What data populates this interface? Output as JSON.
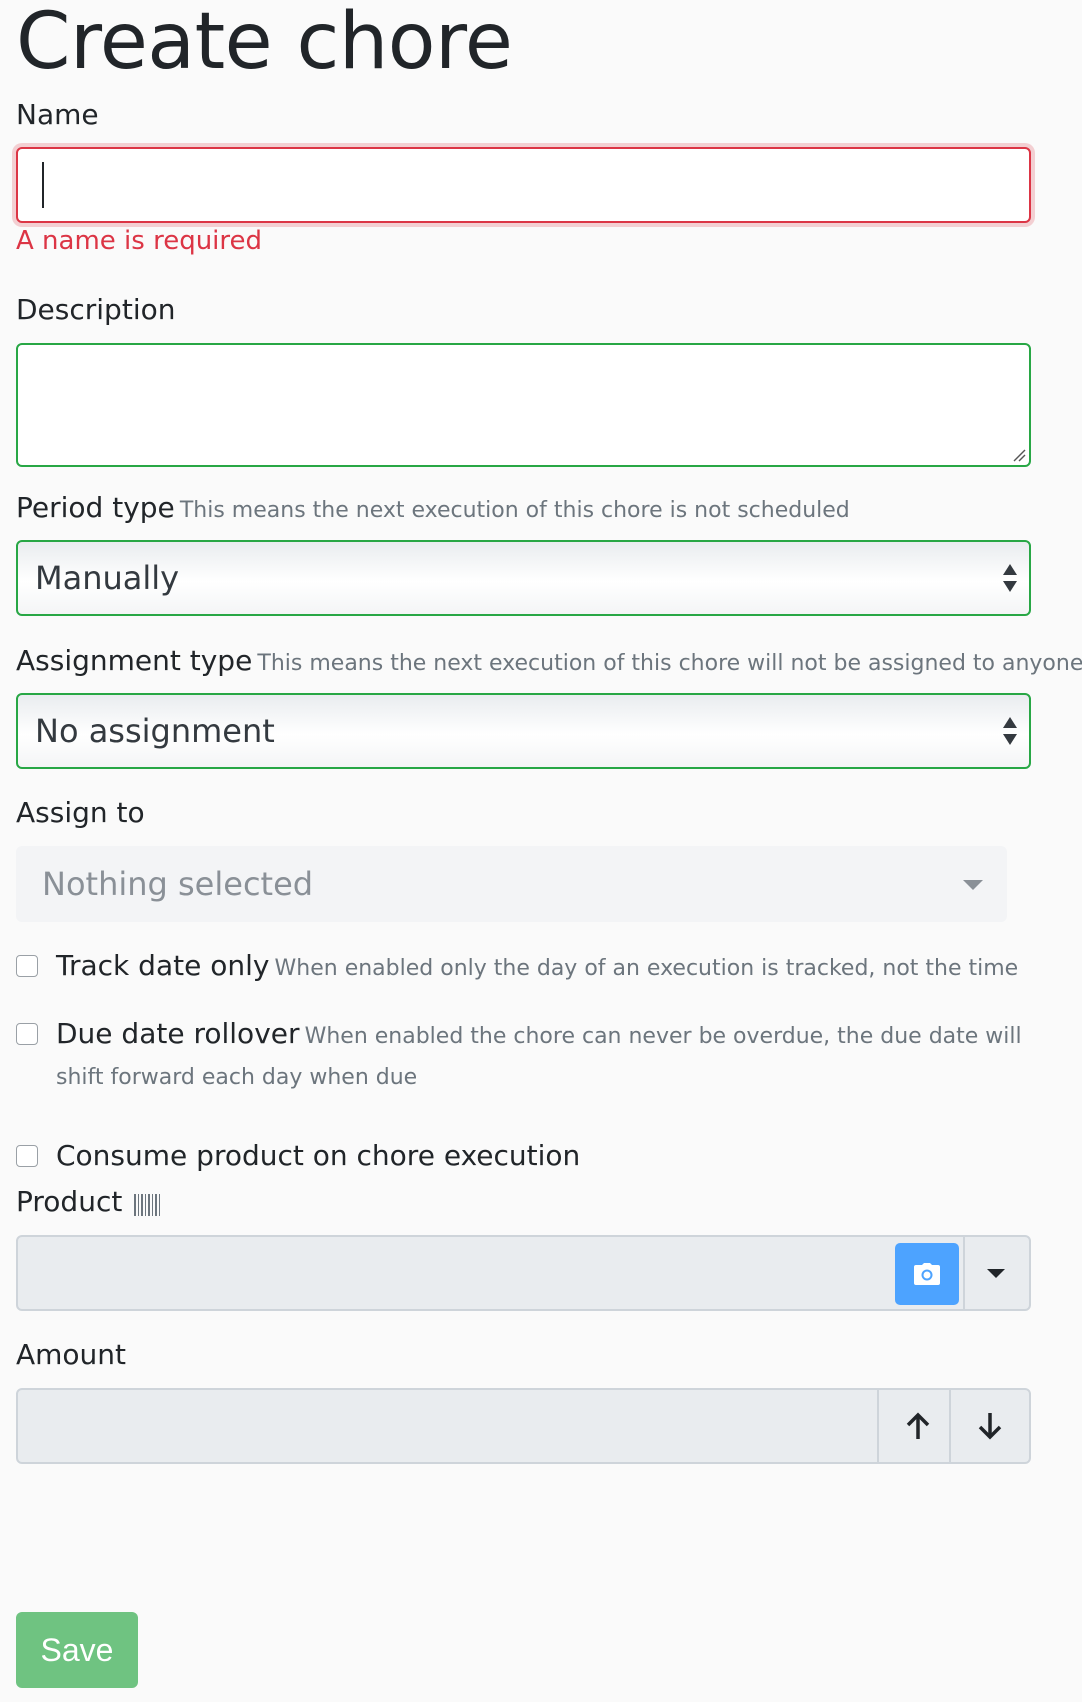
{
  "page": {
    "title": "Create chore"
  },
  "name_field": {
    "label": "Name",
    "value": "",
    "error": "A name is required"
  },
  "description_field": {
    "label": "Description",
    "value": ""
  },
  "period_type": {
    "label": "Period type",
    "hint": "This means the next execution of this chore is not scheduled",
    "selected": "Manually"
  },
  "assignment_type": {
    "label": "Assignment type",
    "hint": "This means the next execution of this chore will not be assigned to anyone",
    "selected": "No assignment"
  },
  "assign_to": {
    "label": "Assign to",
    "selected": "Nothing selected"
  },
  "track_date_only": {
    "label": "Track date only",
    "hint": "When enabled only the day of an execution is tracked, not the time",
    "checked": false
  },
  "due_date_rollover": {
    "label": "Due date rollover",
    "hint": "When enabled the chore can never be overdue, the due date will shift forward each day when due",
    "checked": false
  },
  "consume_product": {
    "label": "Consume product on chore execution",
    "checked": false
  },
  "product": {
    "label": "Product",
    "value": "",
    "barcode_icon": "barcode-icon",
    "camera_icon": "camera-icon"
  },
  "amount": {
    "label": "Amount",
    "value": ""
  },
  "actions": {
    "save_label": "Save"
  },
  "colors": {
    "invalid": "#dc3545",
    "valid": "#28a745",
    "primary": "#4da3ff",
    "success": "#6fc381"
  }
}
